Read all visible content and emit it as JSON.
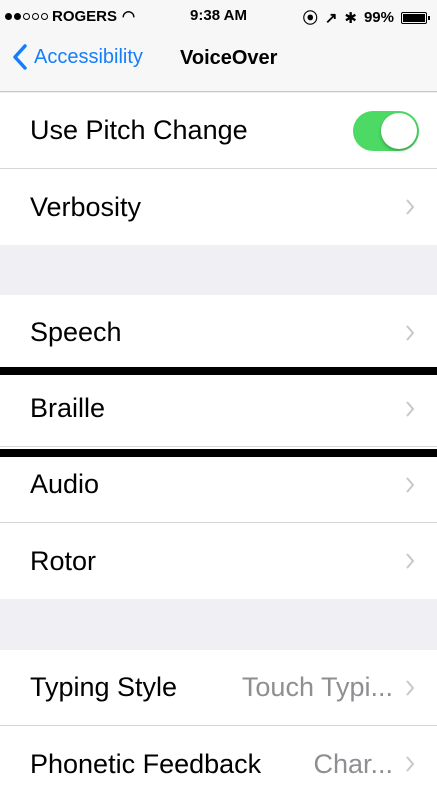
{
  "status_bar": {
    "carrier": "ROGERS",
    "time": "9:38 AM",
    "battery_text": "99%",
    "battery_level": 0.99
  },
  "nav": {
    "back_label": "Accessibility",
    "title": "VoiceOver"
  },
  "colors": {
    "accent": "#157efb",
    "toggle_on": "#4cd964",
    "background": "#efeff4"
  },
  "settings": {
    "use_pitch_change": {
      "label": "Use Pitch Change",
      "on": true
    },
    "verbosity": {
      "label": "Verbosity"
    },
    "speech": {
      "label": "Speech"
    },
    "braille": {
      "label": "Braille"
    },
    "audio": {
      "label": "Audio"
    },
    "rotor": {
      "label": "Rotor"
    },
    "typing_style": {
      "label": "Typing Style",
      "value": "Touch Typi..."
    },
    "phonetic_feedback": {
      "label": "Phonetic Feedback",
      "value": "Char..."
    }
  }
}
